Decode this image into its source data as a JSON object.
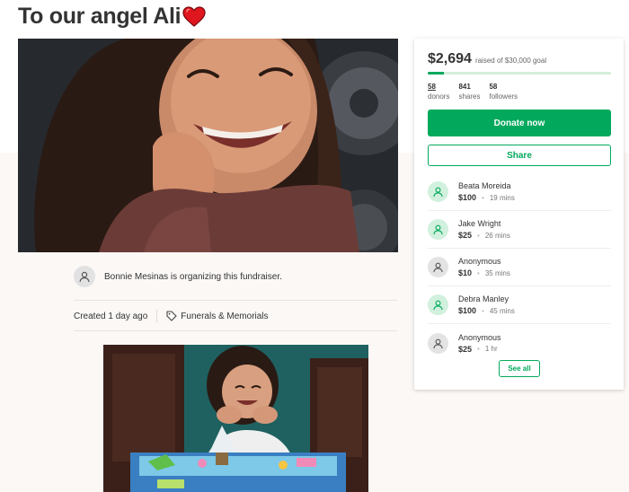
{
  "page": {
    "title": "To our angel Ali",
    "title_emoji": "red-heart-icon"
  },
  "organizer": {
    "text": "Bonnie Mesinas is organizing this fundraiser.",
    "icon": "user-icon"
  },
  "meta": {
    "created": "Created 1 day ago",
    "category": "Funerals & Memorials",
    "category_icon": "tag-icon"
  },
  "campaign": {
    "raised": "$2,694",
    "goal_text": "raised of $30,000 goal",
    "progress_fraction": 0.09,
    "stats": [
      {
        "value": "58",
        "label": "donors"
      },
      {
        "value": "841",
        "label": "shares"
      },
      {
        "value": "58",
        "label": "followers"
      }
    ],
    "donate_label": "Donate now",
    "share_label": "Share",
    "see_all_label": "See all"
  },
  "donations": [
    {
      "name": "Beata Moreida",
      "amount": "$100",
      "time": "19 mins",
      "avatar": "green"
    },
    {
      "name": "Jake Wright",
      "amount": "$25",
      "time": "26 mins",
      "avatar": "green"
    },
    {
      "name": "Anonymous",
      "amount": "$10",
      "time": "35 mins",
      "avatar": "grey"
    },
    {
      "name": "Debra Manley",
      "amount": "$100",
      "time": "45 mins",
      "avatar": "green"
    },
    {
      "name": "Anonymous",
      "amount": "$25",
      "time": "1 hr",
      "avatar": "grey"
    }
  ],
  "colors": {
    "brand_green": "#02a95c",
    "text": "#333333",
    "heart": "#e0161e"
  }
}
